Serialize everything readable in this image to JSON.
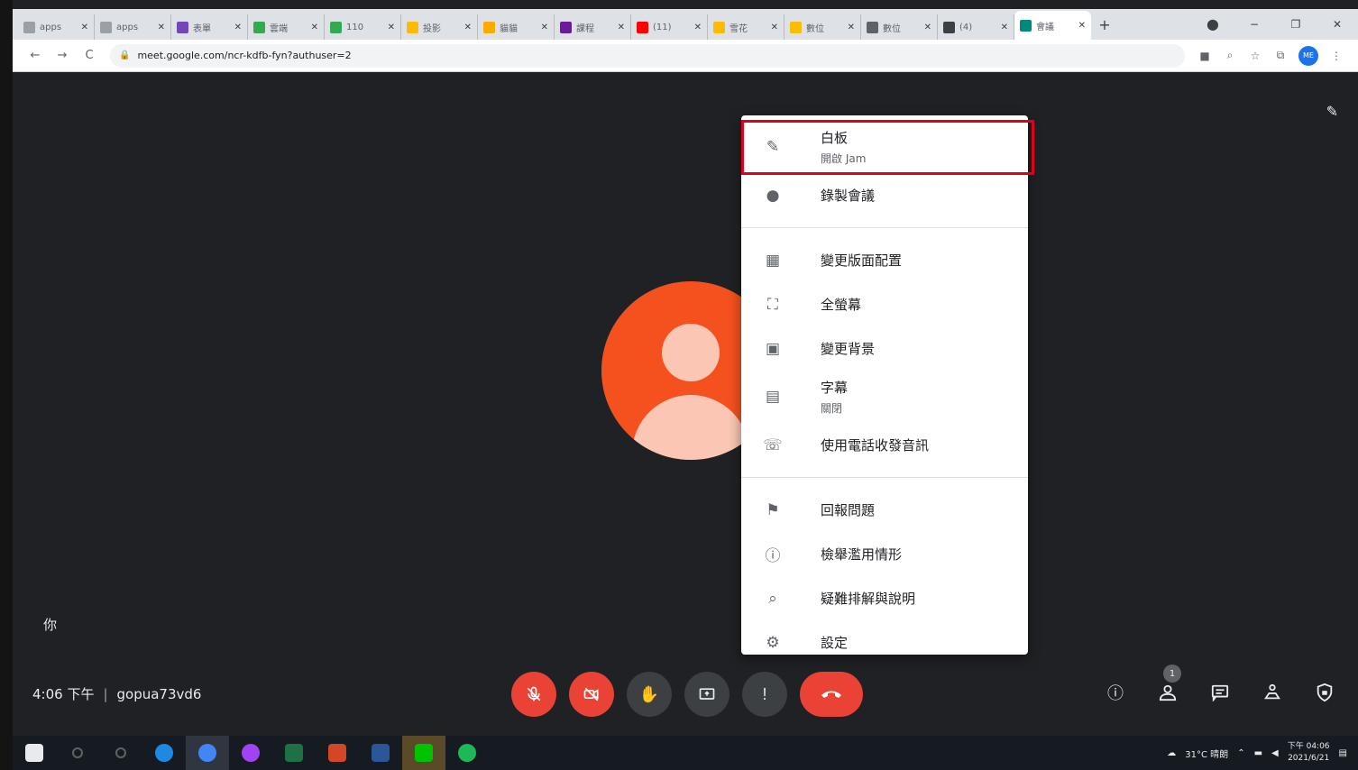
{
  "browser": {
    "tabs": [
      {
        "title": "apps",
        "color": "#9aa0a6"
      },
      {
        "title": "apps",
        "color": "#9aa0a6"
      },
      {
        "title": "表單",
        "color": "#7248b9"
      },
      {
        "title": "雲端",
        "color": "#34a853"
      },
      {
        "title": "110",
        "color": "#34a853"
      },
      {
        "title": "投影",
        "color": "#fbbc04"
      },
      {
        "title": "貓貓",
        "color": "#f9ab00"
      },
      {
        "title": "課程",
        "color": "#6a1b9a"
      },
      {
        "title": "(11)",
        "color": "#ff0000"
      },
      {
        "title": "雪花",
        "color": "#fbbc04"
      },
      {
        "title": "數位",
        "color": "#fbbc04"
      },
      {
        "title": "數位",
        "color": "#5f6368"
      },
      {
        "title": "(4)",
        "color": "#3c4043"
      },
      {
        "title": "會議",
        "color": "#00897b"
      }
    ],
    "active_tab_index": 13,
    "tab_close": "✕",
    "new_tab": "+",
    "window_controls": {
      "menu": "⬤",
      "minimize": "−",
      "restore": "❐",
      "close": "✕"
    },
    "url": "meet.google.com/ncr-kdfb-fyn?authuser=2",
    "nav": {
      "back": "←",
      "forward": "→",
      "reload": "C"
    },
    "profile_initials": "ME"
  },
  "meet": {
    "self_label": "你",
    "time": "4:06 下午",
    "separator": "|",
    "meeting_code": "gopua73vd6",
    "participant_count": "1",
    "menu": {
      "items": [
        {
          "label": "白板",
          "sub": "開啟 Jam",
          "icon": "✎",
          "name": "whiteboard"
        },
        {
          "label": "錄製會議",
          "sub": "",
          "icon": "●",
          "name": "record-meeting"
        },
        {
          "divider": true
        },
        {
          "label": "變更版面配置",
          "sub": "",
          "icon": "▦",
          "name": "change-layout"
        },
        {
          "label": "全螢幕",
          "sub": "",
          "icon": "⛶",
          "name": "full-screen"
        },
        {
          "label": "變更背景",
          "sub": "",
          "icon": "▣",
          "name": "change-background"
        },
        {
          "label": "字幕",
          "sub": "關閉",
          "icon": "▤",
          "name": "captions"
        },
        {
          "label": "使用電話收發音訊",
          "sub": "",
          "icon": "☏",
          "name": "use-phone-audio"
        },
        {
          "divider": true
        },
        {
          "label": "回報問題",
          "sub": "",
          "icon": "⚑",
          "name": "report-problem"
        },
        {
          "label": "檢舉濫用情形",
          "sub": "",
          "icon": "ⓘ",
          "name": "report-abuse"
        },
        {
          "label": "疑難排解與說明",
          "sub": "",
          "icon": "⌕",
          "name": "troubleshooting-help"
        },
        {
          "label": "設定",
          "sub": "",
          "icon": "⚙",
          "name": "settings"
        }
      ]
    }
  },
  "taskbar": {
    "apps": [
      {
        "name": "windows-start",
        "color": "#e8eaed"
      },
      {
        "name": "search",
        "color": "#5f6368"
      },
      {
        "name": "task-view",
        "color": "#5f6368"
      },
      {
        "name": "edge",
        "color": "#1e88e5"
      },
      {
        "name": "chrome",
        "color": "#4285f4"
      },
      {
        "name": "messenger",
        "color": "#a142f4"
      },
      {
        "name": "excel",
        "color": "#1e7145"
      },
      {
        "name": "powerpoint",
        "color": "#d24726"
      },
      {
        "name": "word",
        "color": "#2b579a"
      },
      {
        "name": "line",
        "color": "#00c300"
      },
      {
        "name": "spotify",
        "color": "#1db954"
      }
    ],
    "weather": "31°C 晴朗",
    "clock_time": "下午 04:06",
    "clock_date": "2021/6/21"
  }
}
